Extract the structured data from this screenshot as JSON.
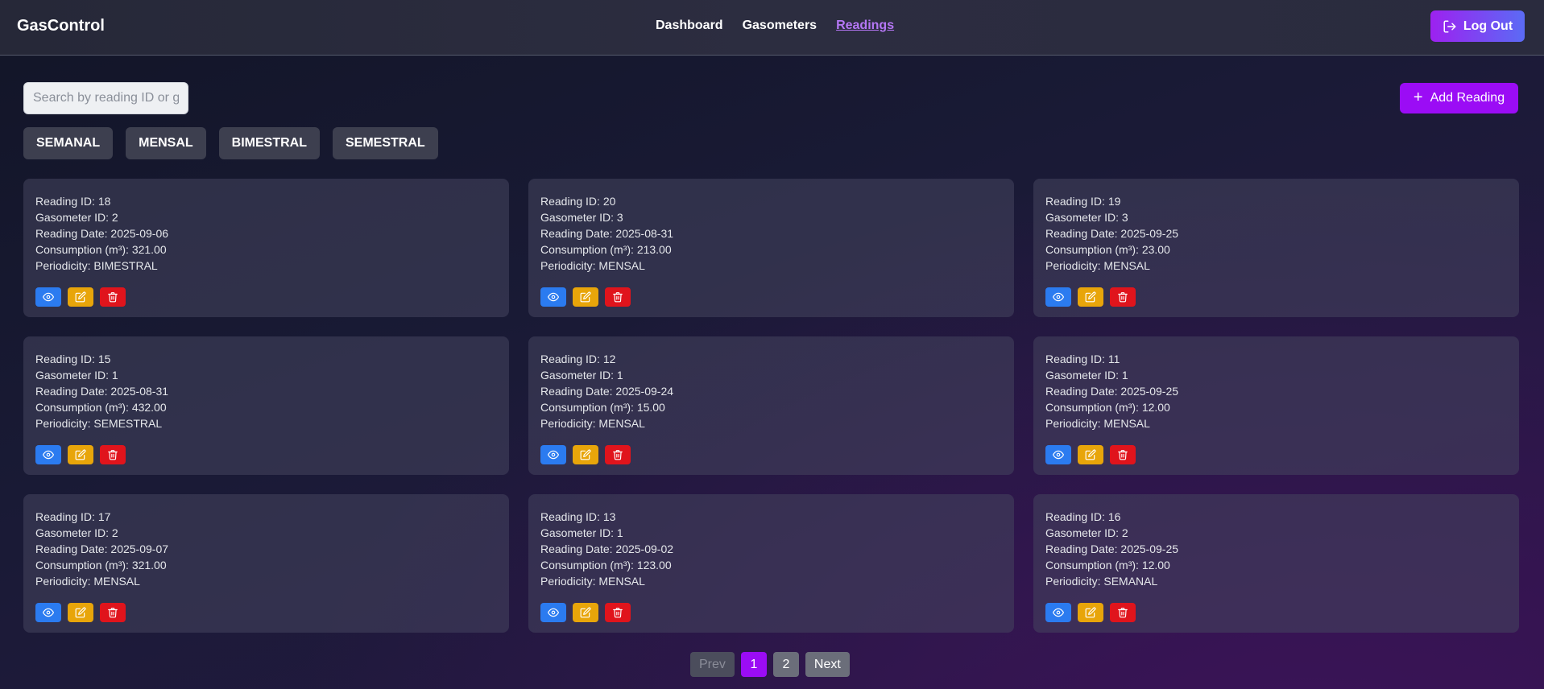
{
  "brand": "GasControl",
  "nav": [
    {
      "label": "Dashboard",
      "active": false
    },
    {
      "label": "Gasometers",
      "active": false
    },
    {
      "label": "Readings",
      "active": true
    }
  ],
  "logout_label": "Log Out",
  "search": {
    "placeholder": "Search by reading ID or gasometer ID",
    "value": ""
  },
  "add_label": "Add Reading",
  "filters": [
    "SEMANAL",
    "MENSAL",
    "BIMESTRAL",
    "SEMESTRAL"
  ],
  "labels": {
    "reading_id": "Reading ID: ",
    "gasometer_id": "Gasometer ID: ",
    "reading_date": "Reading Date: ",
    "consumption": "Consumption (m³): ",
    "periodicity": "Periodicity: "
  },
  "readings": [
    {
      "reading_id": "18",
      "gasometer_id": "2",
      "date": "2025-09-06",
      "consumption": "321.00",
      "periodicity": "BIMESTRAL"
    },
    {
      "reading_id": "20",
      "gasometer_id": "3",
      "date": "2025-08-31",
      "consumption": "213.00",
      "periodicity": "MENSAL"
    },
    {
      "reading_id": "19",
      "gasometer_id": "3",
      "date": "2025-09-25",
      "consumption": "23.00",
      "periodicity": "MENSAL"
    },
    {
      "reading_id": "15",
      "gasometer_id": "1",
      "date": "2025-08-31",
      "consumption": "432.00",
      "periodicity": "SEMESTRAL"
    },
    {
      "reading_id": "12",
      "gasometer_id": "1",
      "date": "2025-09-24",
      "consumption": "15.00",
      "periodicity": "MENSAL"
    },
    {
      "reading_id": "11",
      "gasometer_id": "1",
      "date": "2025-09-25",
      "consumption": "12.00",
      "periodicity": "MENSAL"
    },
    {
      "reading_id": "17",
      "gasometer_id": "2",
      "date": "2025-09-07",
      "consumption": "321.00",
      "periodicity": "MENSAL"
    },
    {
      "reading_id": "13",
      "gasometer_id": "1",
      "date": "2025-09-02",
      "consumption": "123.00",
      "periodicity": "MENSAL"
    },
    {
      "reading_id": "16",
      "gasometer_id": "2",
      "date": "2025-09-25",
      "consumption": "12.00",
      "periodicity": "SEMANAL"
    }
  ],
  "card_actions": [
    {
      "icon": "eye-icon",
      "color": "#2b7bf0"
    },
    {
      "icon": "edit-icon",
      "color": "#e8a50a"
    },
    {
      "icon": "trash-icon",
      "color": "#e0141c"
    }
  ],
  "pagination": {
    "prev": "Prev",
    "pages": [
      "1",
      "2"
    ],
    "current": "1",
    "next": "Next"
  },
  "colors": {
    "accent": "#9b0cf5",
    "active_nav": "#b577f5"
  }
}
